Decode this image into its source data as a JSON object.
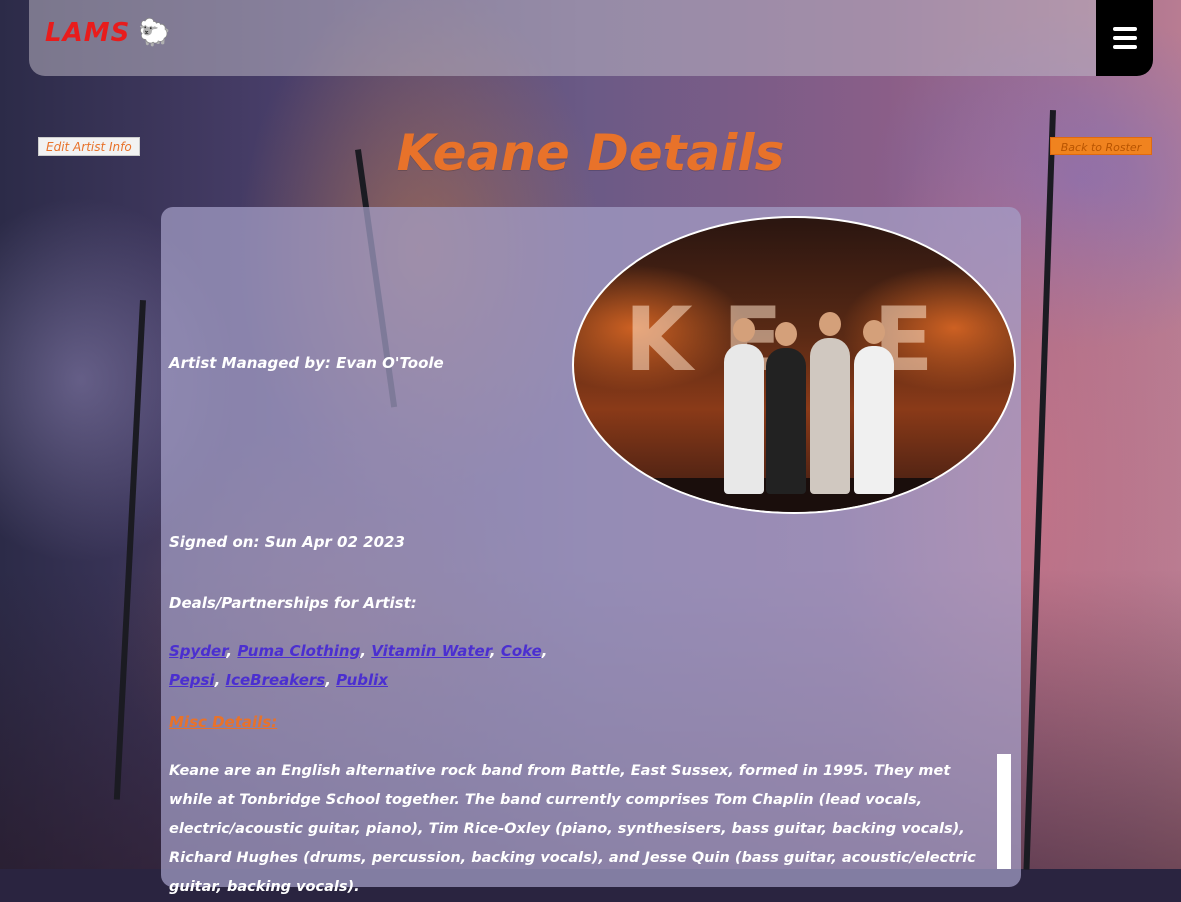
{
  "navbar": {
    "brand": "LAMS",
    "brand_icon": "🐑",
    "menu_icon": "hamburger-menu-icon"
  },
  "actions": {
    "edit_label": "Edit Artist Info",
    "back_label": "Back to Roster"
  },
  "page": {
    "title": "Keane Details"
  },
  "artist": {
    "photo_letters": "KE E",
    "managed_by": "Artist Managed by: Evan O'Toole",
    "signed_on": "Signed on: Sun Apr 02 2023",
    "deals_heading": "Deals/Partnerships for Artist:",
    "deals": [
      "Spyder",
      "Puma Clothing",
      "Vitamin Water",
      "Coke",
      "Pepsi",
      "IceBreakers",
      "Publix"
    ],
    "misc_heading": "Misc Details:",
    "bio": "Keane are an English alternative rock band from Battle, East Sussex, formed in 1995. They met while at Tonbridge School together. The band currently comprises Tom Chaplin (lead vocals, electric/acoustic guitar, piano), Tim Rice-Oxley (piano, synthesisers, bass guitar, backing vocals), Richard Hughes (drums, percussion, backing vocals), and Jesse Quin (bass guitar, acoustic/electric guitar, backing vocals)."
  },
  "colors": {
    "brand": "#e81c1c",
    "accent": "#e8722a",
    "link": "#4b2fd0"
  }
}
